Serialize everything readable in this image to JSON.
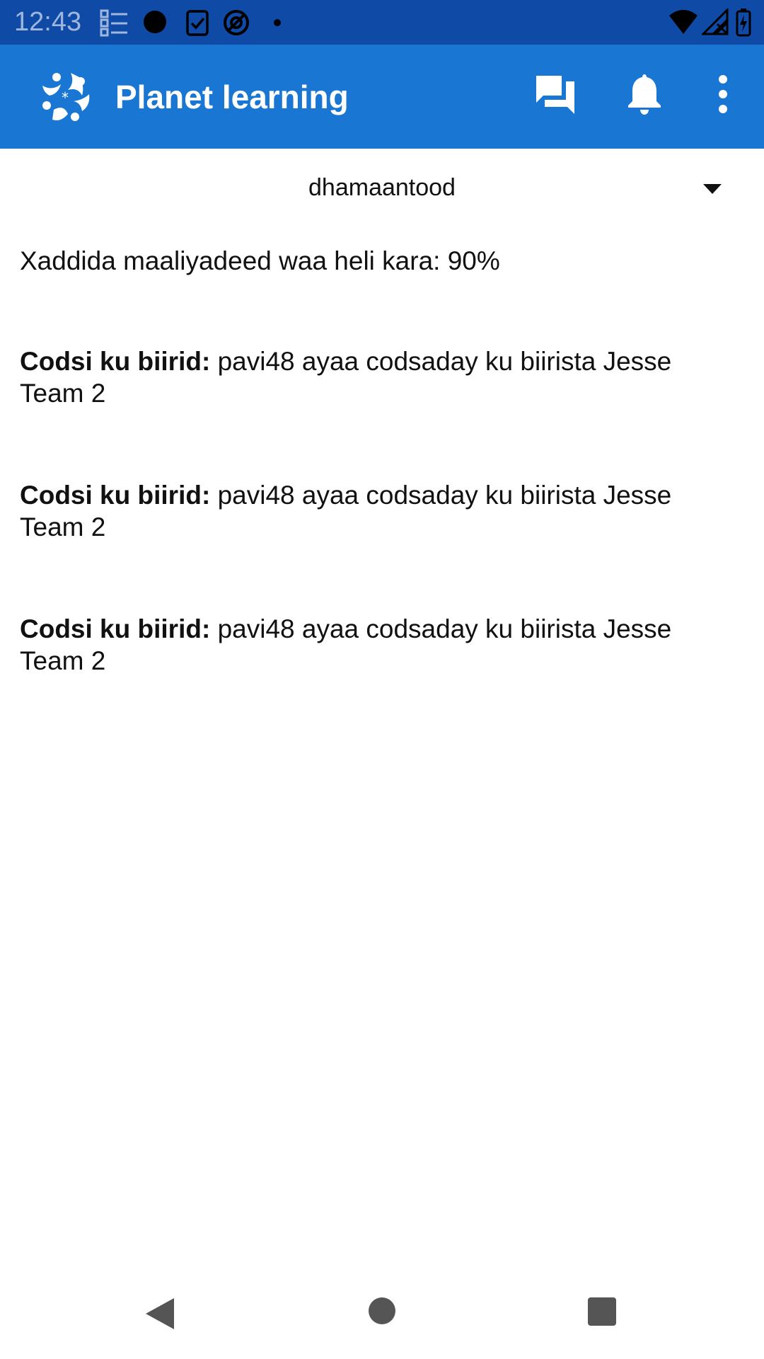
{
  "status_bar": {
    "time": "12:43",
    "left_icons": [
      "checklist-icon",
      "circle-dot-icon",
      "clipboard-check-icon",
      "at-sign-icon",
      "small-dot-icon"
    ],
    "right_icons": [
      "wifi-icon",
      "signal-no-data-icon",
      "battery-charging-icon"
    ]
  },
  "app_bar": {
    "title": "Planet learning",
    "logo": "planet-learning-logo",
    "actions": [
      "chat-icon",
      "bell-icon",
      "overflow-menu-icon"
    ],
    "color": "#1976d2"
  },
  "filter": {
    "selected": "dhamaantood"
  },
  "limit_text": "Xaddida maaliyadeed waa heli kara: 90%",
  "notifications": [
    {
      "label": "Codsi ku biirid:",
      "text": "pavi48 ayaa codsaday ku biirista Jesse Team 2"
    },
    {
      "label": "Codsi ku biirid:",
      "text": "pavi48 ayaa codsaday ku biirista Jesse Team 2"
    },
    {
      "label": "Codsi ku biirid:",
      "text": "pavi48 ayaa codsaday ku biirista Jesse Team 2"
    }
  ],
  "nav_bar": {
    "buttons": [
      "back-icon",
      "home-icon",
      "recents-icon"
    ]
  }
}
